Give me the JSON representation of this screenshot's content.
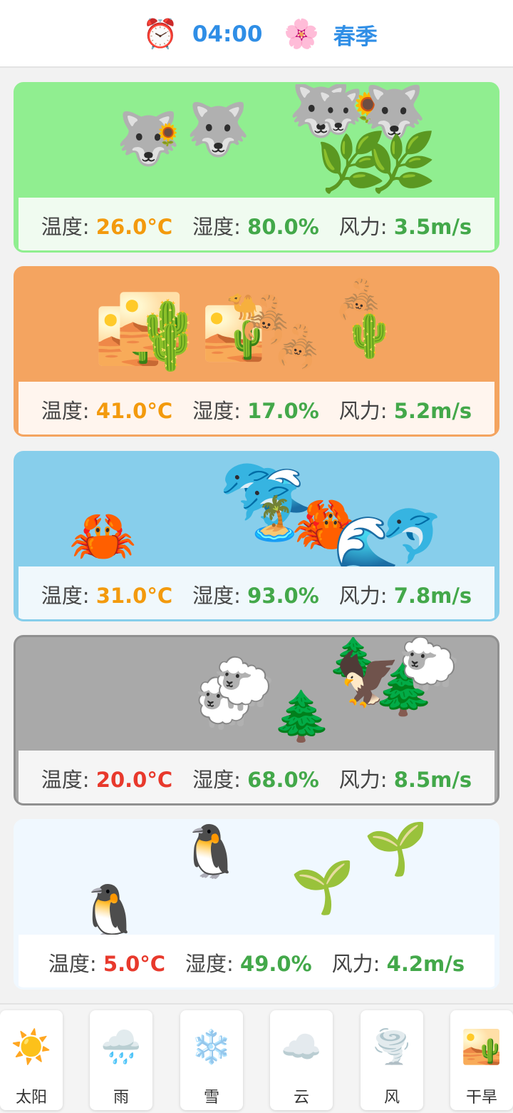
{
  "header": {
    "time_icon": "⏰",
    "time": "04:00",
    "season_icon": "🌸",
    "season": "春季"
  },
  "labels": {
    "temperature": "温度: ",
    "humidity": "湿度: ",
    "wind": "风力: "
  },
  "colors": {
    "accent_blue": "#2f8ee6",
    "value_orange": "#f39a0d",
    "value_green": "#43a84a",
    "value_red": "#e8392c"
  },
  "cards": [
    {
      "biome": "grassland",
      "bg": "#90ee90",
      "border": "#90ee90",
      "panel": "#f0fbf0",
      "temp": "26.0°C",
      "temp_color": "orange",
      "humidity": "80.0%",
      "wind": "3.5m/s",
      "items": [
        "🐺",
        "🌻",
        "🐺",
        "🐺",
        "🐺",
        "🌻",
        "🐺",
        "🌿",
        "🌿"
      ]
    },
    {
      "biome": "desert",
      "bg": "#f4a460",
      "border": "#f4a460",
      "panel": "#fff5ee",
      "temp": "41.0°C",
      "temp_color": "orange",
      "humidity": "17.0%",
      "wind": "5.2m/s",
      "items": [
        "🏜️",
        "🏜️",
        "🌵",
        "🌵",
        "🏜️",
        "🐪",
        "🦂",
        "🦂",
        "🦂",
        "🌵"
      ]
    },
    {
      "biome": "ocean",
      "bg": "#87ceeb",
      "border": "#87ceeb",
      "panel": "#f0f8fc",
      "temp": "31.0°C",
      "temp_color": "orange",
      "humidity": "93.0%",
      "wind": "7.8m/s",
      "items": [
        "🦀",
        "🐬",
        "🌊",
        "🐬",
        "🏝️",
        "🦀",
        "🦀",
        "🌊",
        "🐬"
      ]
    },
    {
      "biome": "forest",
      "bg": "#a9a9a9",
      "border": "#909090",
      "panel": "#f5f5f5",
      "temp": "20.0°C",
      "temp_color": "red",
      "humidity": "68.0%",
      "wind": "8.5m/s",
      "items": [
        "🐑",
        "🐑",
        "🌲",
        "🌲",
        "🦅",
        "🌲",
        "🐑"
      ]
    },
    {
      "biome": "polar",
      "bg": "#f0f8ff",
      "border": "#f0f8ff",
      "panel": "#ffffff",
      "temp": "5.0°C",
      "temp_color": "red",
      "humidity": "49.0%",
      "wind": "4.2m/s",
      "items": [
        "🐧",
        "🐧",
        "🌱",
        "🌱"
      ]
    }
  ],
  "toolbar": [
    {
      "icon": "☀️",
      "label": "太阳",
      "icon_name": "sun-icon"
    },
    {
      "icon": "🌧️",
      "label": "雨",
      "icon_name": "rain-icon"
    },
    {
      "icon": "❄️",
      "label": "雪",
      "icon_name": "snowflake-icon"
    },
    {
      "icon": "☁️",
      "label": "云",
      "icon_name": "cloud-icon"
    },
    {
      "icon": "🌪️",
      "label": "风",
      "icon_name": "tornado-icon"
    },
    {
      "icon": "🏜️",
      "label": "干旱",
      "icon_name": "desert-icon"
    }
  ]
}
